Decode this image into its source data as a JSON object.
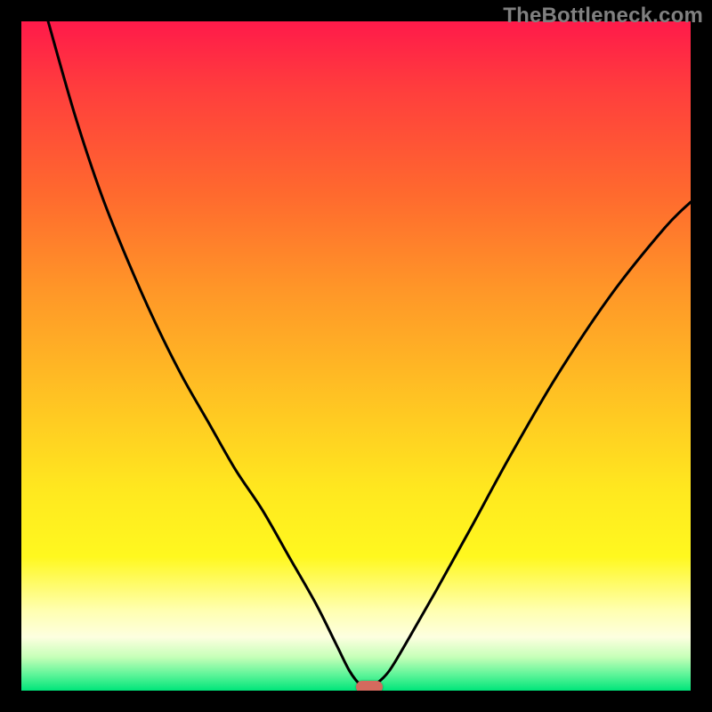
{
  "watermark": "TheBottleneck.com",
  "chart_data": {
    "type": "line",
    "title": "",
    "xlabel": "",
    "ylabel": "",
    "xlim": [
      0,
      100
    ],
    "ylim": [
      0,
      100
    ],
    "series": [
      {
        "name": "bottleneck-curve",
        "x": [
          4,
          8,
          12,
          16,
          20,
          24,
          28,
          32,
          36,
          40,
          44,
          47,
          49,
          50.5,
          51.5,
          52,
          53,
          55,
          58,
          62,
          67,
          73,
          80,
          88,
          96,
          100
        ],
        "y": [
          100,
          86,
          74,
          64,
          55,
          47,
          40,
          33,
          27,
          20,
          13,
          7,
          3,
          1,
          0.5,
          0.5,
          1,
          3,
          8,
          15,
          24,
          35,
          47,
          59,
          69,
          73
        ]
      }
    ],
    "marker": {
      "x": 52,
      "y": 0.5
    },
    "background_gradient": {
      "top": "#ff1a4a",
      "mid": "#ffe81f",
      "bottom": "#00e57a"
    }
  },
  "plot_geometry": {
    "inner_w": 752,
    "inner_h": 752
  }
}
